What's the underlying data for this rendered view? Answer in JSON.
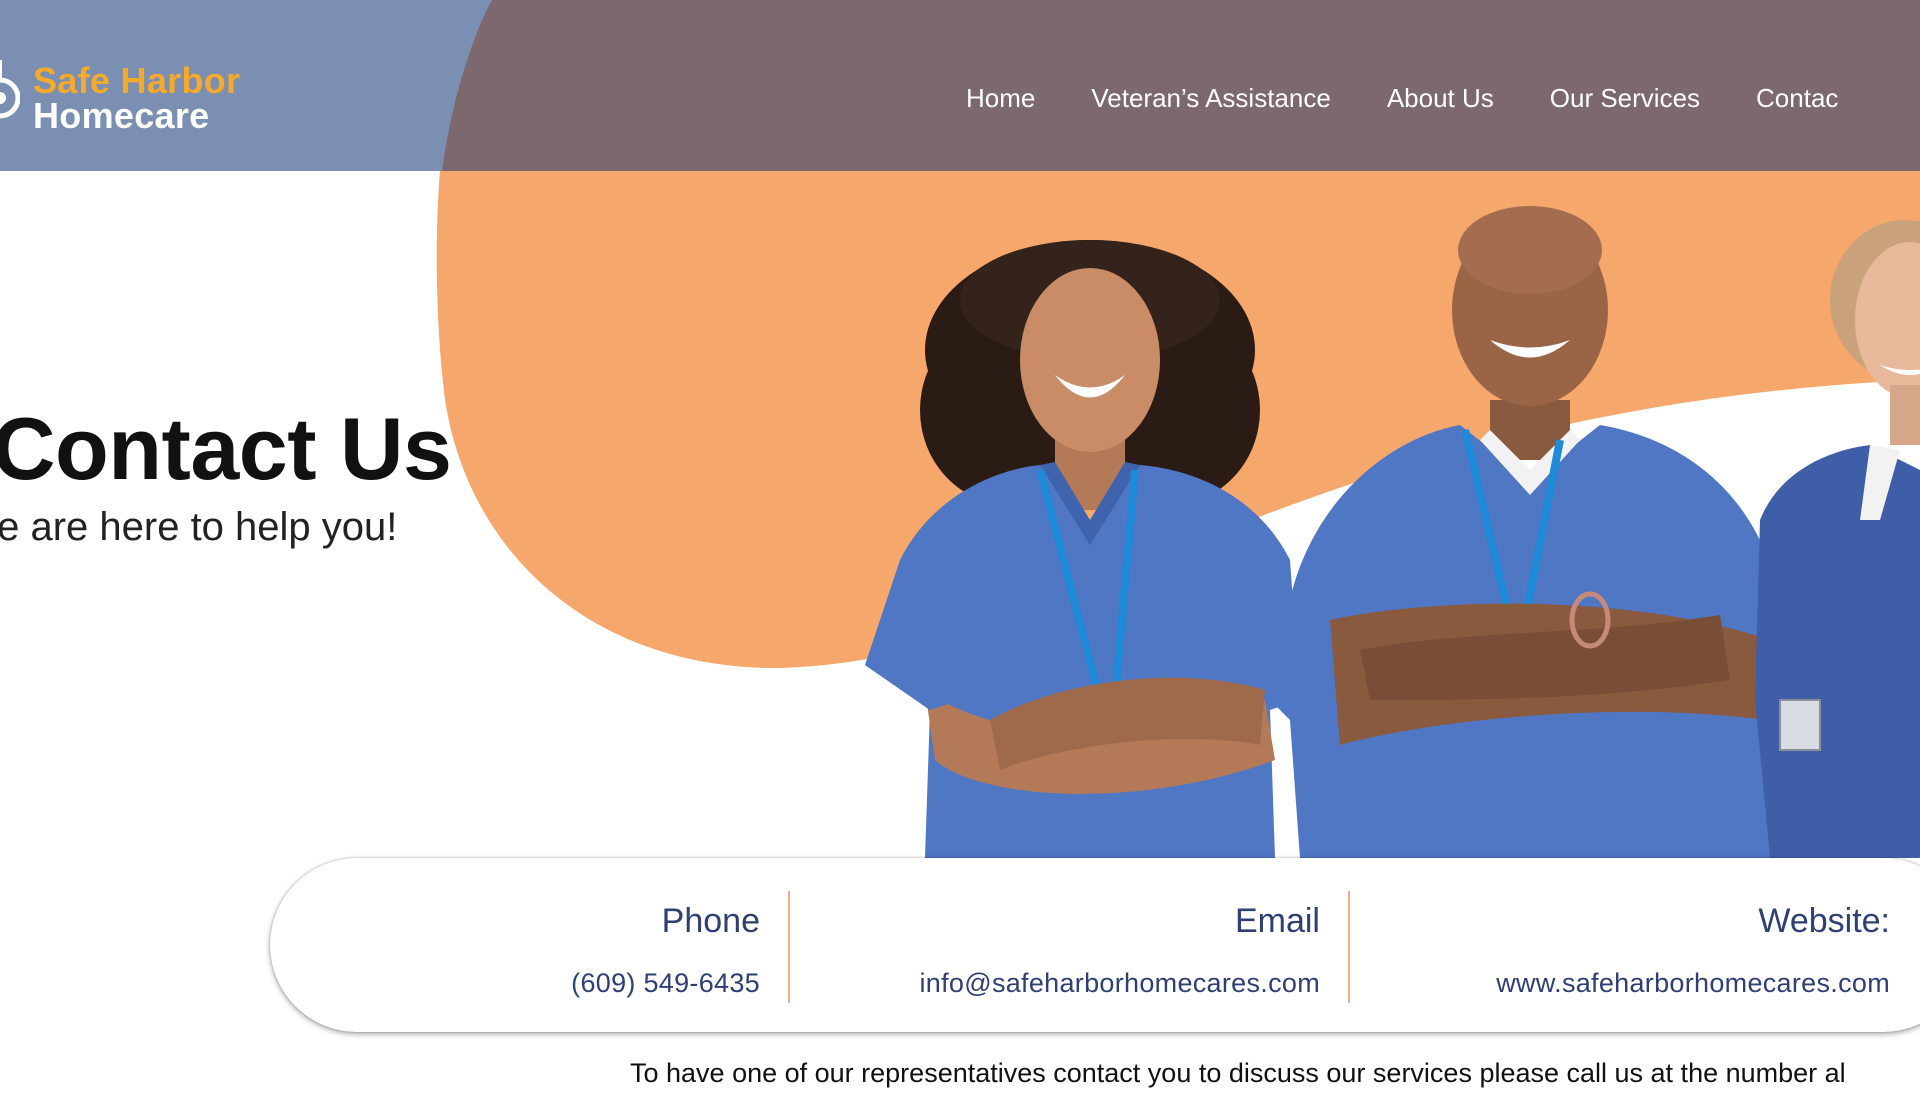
{
  "brand": {
    "name_line1": "Safe Harbor",
    "name_line2": "Homecare"
  },
  "nav": {
    "items": [
      {
        "label": "Home"
      },
      {
        "label": "Veteran’s Assistance"
      },
      {
        "label": "About Us"
      },
      {
        "label": "Our Services"
      },
      {
        "label": "Contac"
      }
    ]
  },
  "hero": {
    "title": "Contact Us",
    "subtitle": "/e are here to help you!"
  },
  "contact": {
    "phone_label": "Phone",
    "phone_value": "(609) 549-6435",
    "email_label": "Email",
    "email_value": "info@safeharborhomecares.com",
    "website_label": "Website:",
    "website_value": "www.safeharborhomecares.com"
  },
  "footer": {
    "note": "To have one of our representatives contact you to discuss our services please call us at the number al"
  },
  "colors": {
    "header_left": "#7a8fb2",
    "header_right": "#7d686d",
    "accent_orange": "#f6a76b",
    "logo_orange": "#f6a92a",
    "contact_text": "#2e3f74",
    "divider": "#f2b08a",
    "scrubs": "#4f77c4"
  },
  "icons": {
    "logo_mark": "ship-wheel-icon"
  }
}
